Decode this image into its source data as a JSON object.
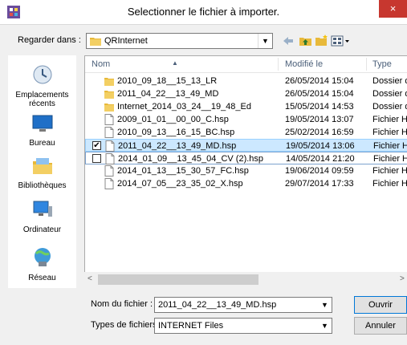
{
  "window": {
    "title": "Selectionner le fichier à importer.",
    "close_glyph": "×"
  },
  "lookin": {
    "label": "Regarder dans :",
    "value": "QRInternet"
  },
  "places": [
    {
      "label": "Emplacements récents",
      "icon": "recent-places-icon"
    },
    {
      "label": "Bureau",
      "icon": "desktop-icon"
    },
    {
      "label": "Bibliothèques",
      "icon": "libraries-icon"
    },
    {
      "label": "Ordinateur",
      "icon": "computer-icon"
    },
    {
      "label": "Réseau",
      "icon": "network-icon"
    }
  ],
  "columns": {
    "name": "Nom",
    "modified": "Modifié le",
    "type": "Type"
  },
  "files": [
    {
      "name": "2010_09_18__15_13_LR",
      "date": "26/05/2014 15:04",
      "type": "Dossier d",
      "kind": "folder",
      "checked": false
    },
    {
      "name": "2011_04_22__13_49_MD",
      "date": "26/05/2014 15:04",
      "type": "Dossier d",
      "kind": "folder",
      "checked": false
    },
    {
      "name": "Internet_2014_03_24__19_48_Ed",
      "date": "15/05/2014 14:53",
      "type": "Dossier d",
      "kind": "folder",
      "checked": false
    },
    {
      "name": "2009_01_01__00_00_C.hsp",
      "date": "19/05/2014 13:07",
      "type": "Fichier H",
      "kind": "file",
      "checked": false
    },
    {
      "name": "2010_09_13__16_15_BC.hsp",
      "date": "25/02/2014 16:59",
      "type": "Fichier H",
      "kind": "file",
      "checked": false
    },
    {
      "name": "2011_04_22__13_49_MD.hsp",
      "date": "19/05/2014 13:06",
      "type": "Fichier H",
      "kind": "file",
      "checked": true
    },
    {
      "name": "2014_01_09__13_45_04_CV (2).hsp",
      "date": "14/05/2014 21:20",
      "type": "Fichier H",
      "kind": "file",
      "checked": false
    },
    {
      "name": "2014_01_13__15_30_57_FC.hsp",
      "date": "19/06/2014 09:59",
      "type": "Fichier H",
      "kind": "file",
      "checked": false
    },
    {
      "name": "2014_07_05__23_35_02_X.hsp",
      "date": "29/07/2014 17:33",
      "type": "Fichier H",
      "kind": "file",
      "checked": false
    }
  ],
  "filename": {
    "label": "Nom du fichier :",
    "value": "2011_04_22__13_49_MD.hsp"
  },
  "filetype": {
    "label": "Types de fichiers :",
    "value": "INTERNET Files"
  },
  "buttons": {
    "open": "Ouvrir",
    "cancel": "Annuler"
  },
  "scroll_glyphs": {
    "left": "<",
    "right": ">"
  },
  "colors": {
    "selection": "#cce8ff",
    "close": "#c7372f",
    "folder": "#e8b93a"
  }
}
